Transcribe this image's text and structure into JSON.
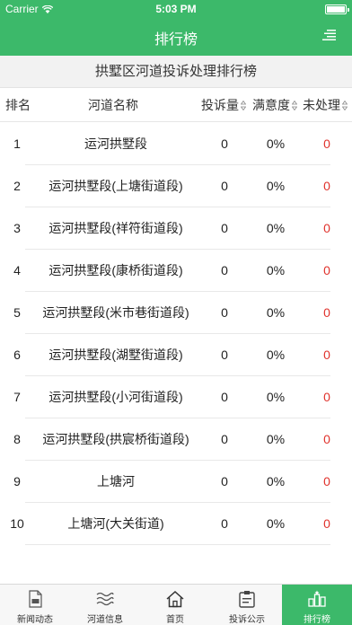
{
  "status_bar": {
    "carrier": "Carrier",
    "time": "5:03 PM"
  },
  "navbar": {
    "title": "排行榜",
    "menu_icon": "list-menu-icon"
  },
  "page": {
    "title": "拱墅区河道投诉处理排行榜"
  },
  "table": {
    "headers": {
      "rank": "排名",
      "name": "河道名称",
      "count": "投诉量",
      "satisfaction": "满意度",
      "pending": "未处理"
    },
    "rows": [
      {
        "rank": "1",
        "name": "运河拱墅段",
        "count": "0",
        "satisfaction": "0%",
        "pending": "0"
      },
      {
        "rank": "2",
        "name": "运河拱墅段(上塘街道段)",
        "count": "0",
        "satisfaction": "0%",
        "pending": "0"
      },
      {
        "rank": "3",
        "name": "运河拱墅段(祥符街道段)",
        "count": "0",
        "satisfaction": "0%",
        "pending": "0"
      },
      {
        "rank": "4",
        "name": "运河拱墅段(康桥街道段)",
        "count": "0",
        "satisfaction": "0%",
        "pending": "0"
      },
      {
        "rank": "5",
        "name": "运河拱墅段(米市巷街道段)",
        "count": "0",
        "satisfaction": "0%",
        "pending": "0"
      },
      {
        "rank": "6",
        "name": "运河拱墅段(湖墅街道段)",
        "count": "0",
        "satisfaction": "0%",
        "pending": "0"
      },
      {
        "rank": "7",
        "name": "运河拱墅段(小河街道段)",
        "count": "0",
        "satisfaction": "0%",
        "pending": "0"
      },
      {
        "rank": "8",
        "name": "运河拱墅段(拱宸桥街道段)",
        "count": "0",
        "satisfaction": "0%",
        "pending": "0"
      },
      {
        "rank": "9",
        "name": "上塘河",
        "count": "0",
        "satisfaction": "0%",
        "pending": "0"
      },
      {
        "rank": "10",
        "name": "上塘河(大关街道)",
        "count": "0",
        "satisfaction": "0%",
        "pending": "0"
      }
    ]
  },
  "tabbar": {
    "tabs": [
      {
        "label": "新闻动态",
        "icon": "document-icon"
      },
      {
        "label": "河道信息",
        "icon": "water-waves-icon"
      },
      {
        "label": "首页",
        "icon": "home-icon"
      },
      {
        "label": "投诉公示",
        "icon": "clipboard-icon"
      },
      {
        "label": "排行榜",
        "icon": "ranking-icon"
      }
    ],
    "active_index": 4
  },
  "colors": {
    "primary": "#3cb96a",
    "pending_red": "#e0322c"
  }
}
